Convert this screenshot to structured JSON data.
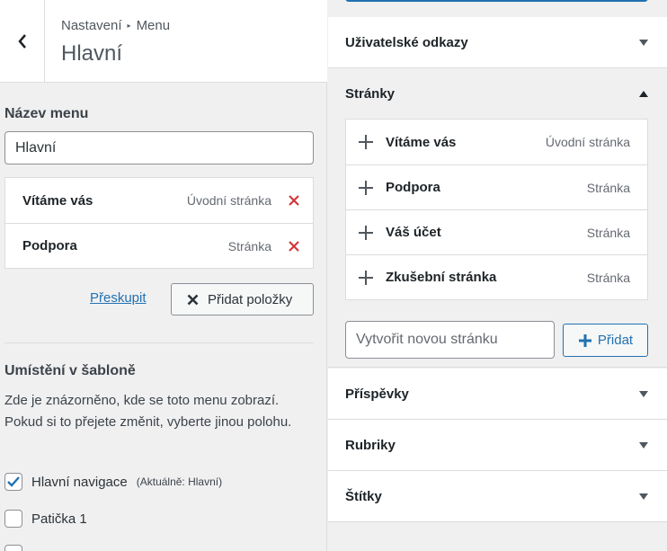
{
  "header": {
    "breadcrumb_root": "Nastavení",
    "breadcrumb_current": "Menu",
    "title": "Hlavní"
  },
  "menu_name": {
    "label": "Název menu",
    "value": "Hlavní"
  },
  "menu_items": [
    {
      "title": "Vítáme vás",
      "type": "Úvodní stránka"
    },
    {
      "title": "Podpora",
      "type": "Stránka"
    }
  ],
  "actions": {
    "reorder": "Přeskupit",
    "add_items": "Přidat položky"
  },
  "locations": {
    "heading": "Umístění v šabloně",
    "description": "Zde je znázorněno, kde se toto menu zobrazí. Pokud si to přejete změnit, vyberte jinou polohu.",
    "options": [
      {
        "label": "Hlavní navigace",
        "note": "(Aktuálně: Hlavní)",
        "checked": true
      },
      {
        "label": "Patička 1",
        "note": "",
        "checked": false
      }
    ]
  },
  "right_panel": {
    "sections_top": [
      {
        "label": "Uživatelské odkazy",
        "expanded": false
      }
    ],
    "pages": {
      "label": "Stránky",
      "expanded": true,
      "items": [
        {
          "title": "Vítáme vás",
          "type": "Úvodní stránka"
        },
        {
          "title": "Podpora",
          "type": "Stránka"
        },
        {
          "title": "Váš účet",
          "type": "Stránka"
        },
        {
          "title": "Zkušební stránka",
          "type": "Stránka"
        }
      ],
      "new_page_placeholder": "Vytvořit novou stránku",
      "add_label": "Přidat"
    },
    "sections_bottom": [
      {
        "label": "Příspěvky",
        "expanded": false
      },
      {
        "label": "Rubriky",
        "expanded": false
      },
      {
        "label": "Štítky",
        "expanded": false
      }
    ]
  },
  "colors": {
    "accent": "#2271b1",
    "remove": "#d63638",
    "checkbox": "#2271b1"
  }
}
